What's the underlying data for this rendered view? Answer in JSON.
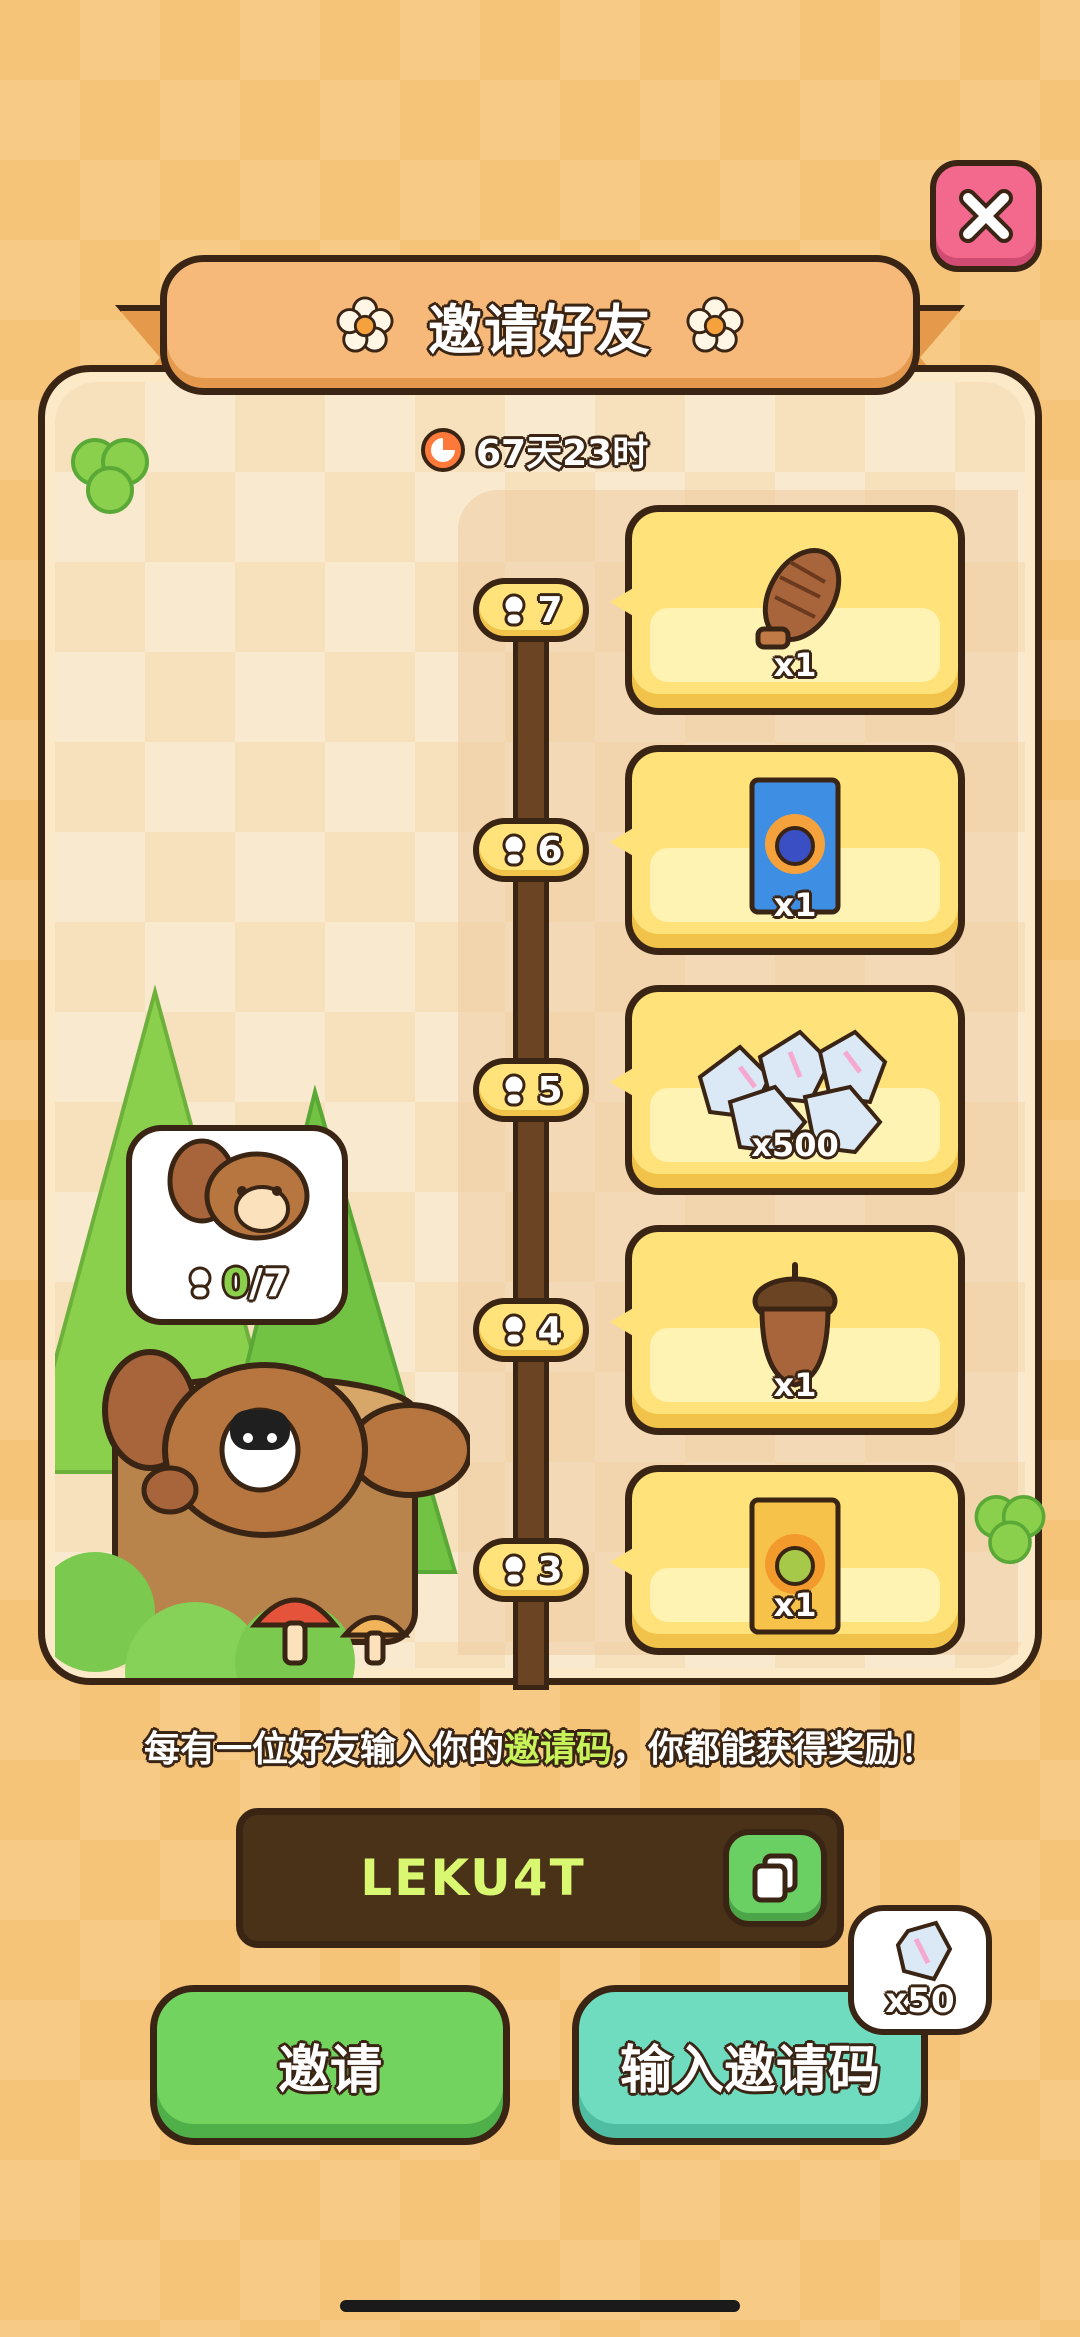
{
  "dialog": {
    "title": "邀请好友",
    "timer_text": "67天23时",
    "close_label": "close"
  },
  "progress": {
    "current": "0",
    "separator": "/",
    "total": "7"
  },
  "milestones": [
    {
      "level": "7",
      "reward_icon": "pinecone-icon",
      "quantity": "x1"
    },
    {
      "level": "6",
      "reward_icon": "blueberry-seed-pack-icon",
      "quantity": "x1"
    },
    {
      "level": "5",
      "reward_icon": "crystal-gems-icon",
      "quantity": "x500"
    },
    {
      "level": "4",
      "reward_icon": "acorn-icon",
      "quantity": "x1"
    },
    {
      "level": "3",
      "reward_icon": "durian-seed-pack-icon",
      "quantity": "x1"
    }
  ],
  "info": {
    "prefix": "每有一位好友输入你的",
    "highlight": "邀请码",
    "suffix": "，你都能获得奖励！"
  },
  "invite_code": "LEKU4T",
  "buttons": {
    "invite": "邀请",
    "enter_code": "输入邀请码"
  },
  "enter_code_bonus": "x50",
  "colors": {
    "background": "#f6c478",
    "card": "#ffe27a",
    "invite_button": "#72d35f",
    "enter_code_button": "#6fdcc0",
    "close_button": "#f3698d",
    "code_text": "#d9f770"
  }
}
